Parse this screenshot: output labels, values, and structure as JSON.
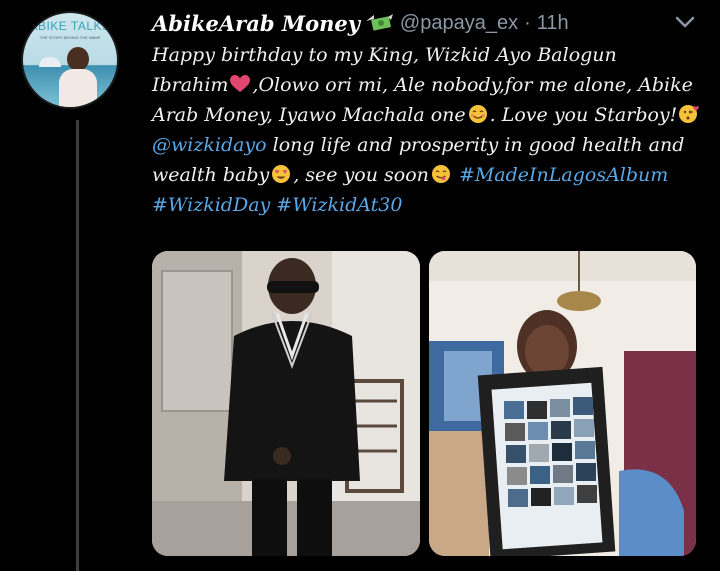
{
  "tweet": {
    "avatar_brand": "ABIKE TALKS",
    "avatar_tagline": "THE STORY BEHIND THE NAME",
    "display_name": "AbikeArab Money",
    "handle": "@papaya_ex",
    "separator": "·",
    "time": "11h",
    "text": {
      "line1": "Happy birthday to my King, Wizkid Ayo Balogun",
      "line2a": "Ibrahim",
      "line2b": ",Olowo ori mi, Ale nobody,for me alone, Abike",
      "line3a": "Arab Money, Iyawo Machala one",
      "line3b": ". Love you Starboy!",
      "mention": "@wizkidayo",
      "line4b": " long life and prosperity in good health and",
      "line5a": "wealth baby",
      "line5b": ", see you soon",
      "hashtag1": "#MadeInLagosAlbum",
      "hashtag2": "#WizkidDay",
      "hashtag3": "#WizkidAt30"
    },
    "icons": [
      "money-with-wings-icon",
      "heart-icon",
      "smiling-face-icon",
      "kissing-face-icon",
      "heart-eyes-face-icon",
      "yum-face-icon",
      "chevron-down-icon"
    ],
    "colors": {
      "background": "#000000",
      "link": "#5aa8e6",
      "muted": "#8b98a5",
      "heart": "#e0466e",
      "emoji": "#f5c23a"
    }
  }
}
